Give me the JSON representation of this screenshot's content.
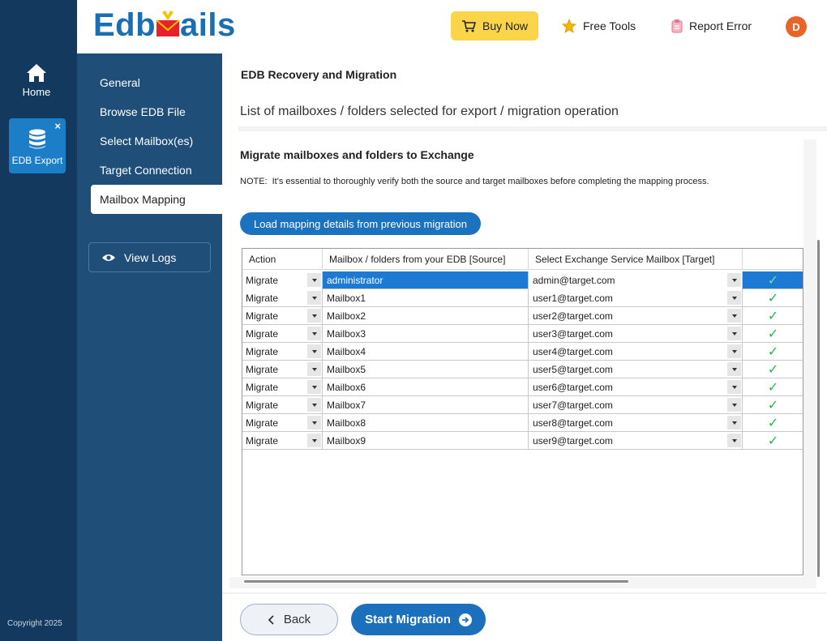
{
  "rail": {
    "home_label": "Home",
    "edb_label": "EDB Export",
    "close_symbol": "×",
    "copyright": "Copyright 2025"
  },
  "header": {
    "logo_left": "Edb",
    "logo_right": "ails",
    "buy_now": "Buy Now",
    "free_tools": "Free Tools",
    "report_error": "Report Error",
    "avatar_initial": "D"
  },
  "wizard": {
    "items": [
      {
        "label": "General"
      },
      {
        "label": "Browse EDB  File"
      },
      {
        "label": "Select Mailbox(es)"
      },
      {
        "label": "Target Connection"
      },
      {
        "label": "Mailbox Mapping"
      }
    ],
    "view_logs": "View Logs"
  },
  "main": {
    "section_title": "EDB Recovery and Migration",
    "sub_title": "List of mailboxes / folders selected for export / migration operation",
    "panel_title": "Migrate mailboxes and folders to Exchange",
    "note_label": "NOTE:",
    "note_text": "It's essential to thoroughly verify both the source and target mailboxes before completing the mapping process.",
    "load_button": "Load mapping details from previous migration"
  },
  "table": {
    "headers": [
      "Action",
      "Mailbox / folders from your EDB [Source]",
      "Select Exchange Service Mailbox [Target]",
      ""
    ],
    "rows": [
      {
        "action": "Migrate",
        "source": "administrator",
        "target": "admin@target.com"
      },
      {
        "action": "Migrate",
        "source": "Mailbox1",
        "target": "user1@target.com"
      },
      {
        "action": "Migrate",
        "source": "Mailbox2",
        "target": "user2@target.com"
      },
      {
        "action": "Migrate",
        "source": "Mailbox3",
        "target": "user3@target.com"
      },
      {
        "action": "Migrate",
        "source": "Mailbox4",
        "target": "user4@target.com"
      },
      {
        "action": "Migrate",
        "source": "Mailbox5",
        "target": "user5@target.com"
      },
      {
        "action": "Migrate",
        "source": "Mailbox6",
        "target": "user6@target.com"
      },
      {
        "action": "Migrate",
        "source": "Mailbox7",
        "target": "user7@target.com"
      },
      {
        "action": "Migrate",
        "source": "Mailbox8",
        "target": "user8@target.com"
      },
      {
        "action": "Migrate",
        "source": "Mailbox9",
        "target": "user9@target.com"
      }
    ],
    "check_symbol": "✓"
  },
  "footer": {
    "back": "Back",
    "start": "Start Migration"
  },
  "colors": {
    "rail": "#133a5e",
    "wizard": "#1f4e78",
    "accent": "#1b72be",
    "buy": "#fad54a",
    "avatar": "#e8652a",
    "check": "#27b84f"
  }
}
